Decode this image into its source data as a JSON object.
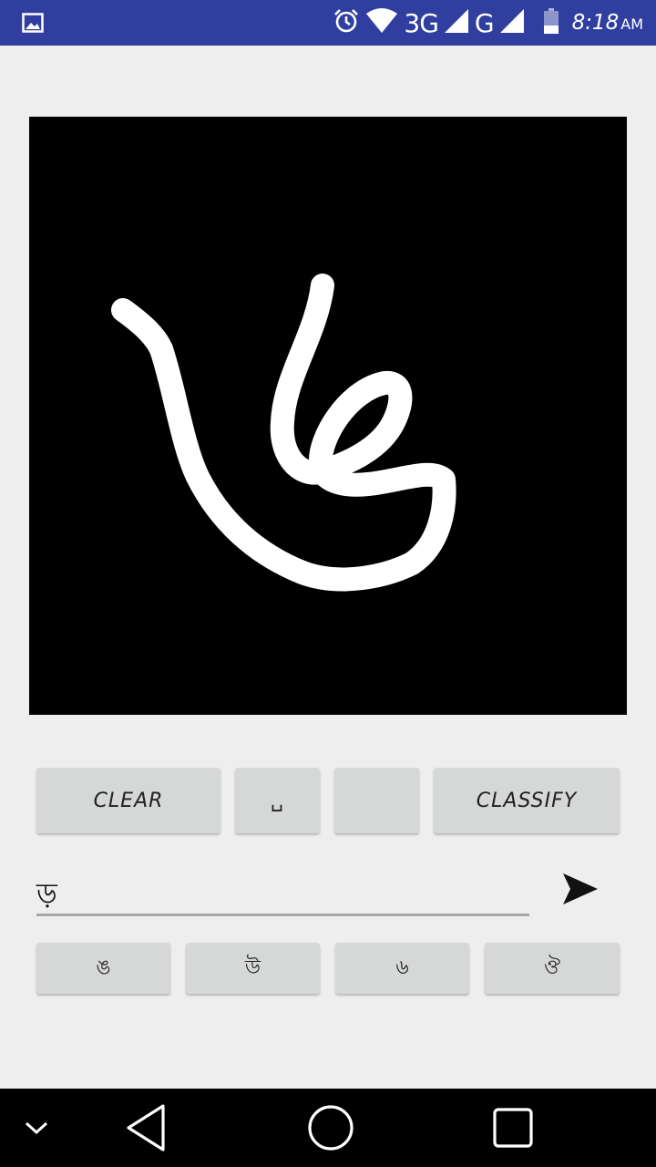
{
  "status_bar": {
    "network_3g": "3G",
    "network_g": "G",
    "time": "8:18",
    "ampm": "AM",
    "icons": [
      "image-icon",
      "alarm-icon",
      "wifi-icon",
      "signal-icon",
      "signal-icon",
      "battery-icon"
    ]
  },
  "canvas": {
    "background": "#000000",
    "stroke_color": "#ffffff"
  },
  "buttons": {
    "clear": "CLEAR",
    "space": "␣",
    "blank": "",
    "classify": "CLASSIFY"
  },
  "input": {
    "value": "ড়"
  },
  "suggestions": [
    "ঙ",
    "উ",
    "৬",
    "ঔ"
  ],
  "colors": {
    "status_bar": "#303f9f",
    "background": "#eeeeee",
    "button": "#d6d7d7",
    "nav_bar": "#000000"
  },
  "nav": {
    "icons": [
      "chevron-down-icon",
      "back-icon",
      "home-icon",
      "recents-icon"
    ]
  }
}
